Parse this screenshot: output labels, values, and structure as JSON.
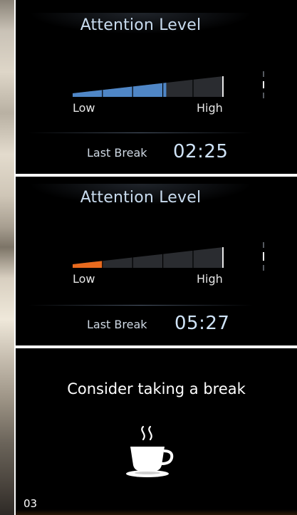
{
  "screens": [
    {
      "title": "Attention Level",
      "meter": {
        "low_label": "Low",
        "high_label": "High",
        "level_fraction": 0.62,
        "fill_color": "#4f86c6",
        "segments": 5
      },
      "last_break": {
        "label": "Last Break",
        "time": "02:25"
      }
    },
    {
      "title": "Attention Level",
      "meter": {
        "low_label": "Low",
        "high_label": "High",
        "level_fraction": 0.2,
        "fill_color": "#e86a1e",
        "segments": 5
      },
      "last_break": {
        "label": "Last Break",
        "time": "05:27"
      }
    },
    {
      "message": "Consider taking a break",
      "icon": "coffee-cup-icon"
    }
  ],
  "page_number": "03"
}
